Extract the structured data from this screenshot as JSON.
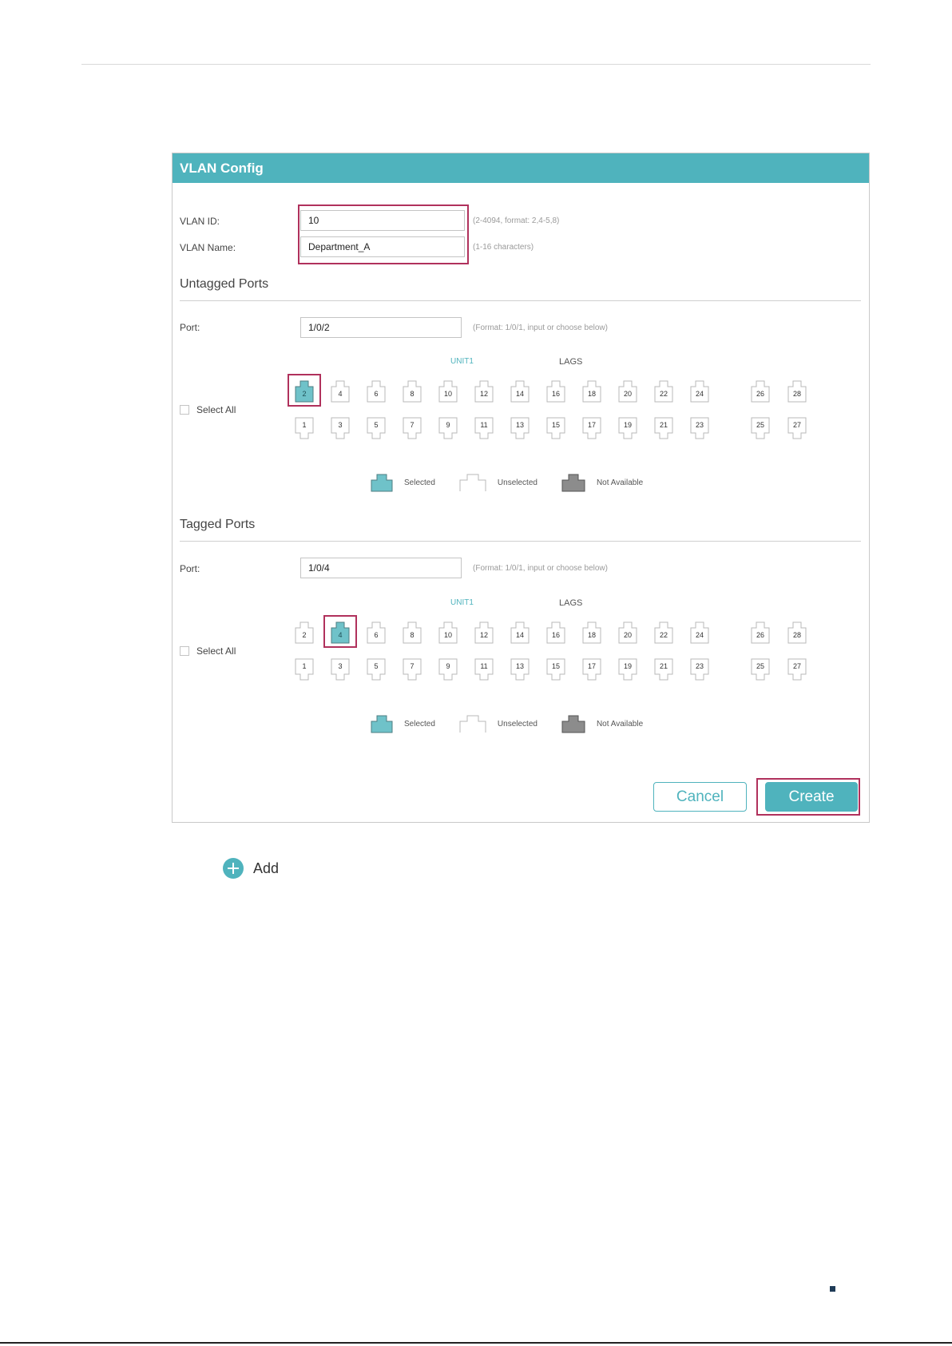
{
  "panel": {
    "title": "VLAN Config",
    "vlan_id": {
      "label": "VLAN ID:",
      "value": "10",
      "hint": "(2-4094, format: 2,4-5,8)"
    },
    "vlan_name": {
      "label": "VLAN Name:",
      "value": "Department_A",
      "hint": "(1-16 characters)"
    },
    "untagged": {
      "title": "Untagged Ports",
      "port_label": "Port:",
      "port_value": "1/0/2",
      "port_hint": "(Format: 1/0/1, input or choose below)",
      "unit_label": "UNIT1",
      "lags_label": "LAGS",
      "select_all": "Select All",
      "selected_port": "2"
    },
    "tagged": {
      "title": "Tagged Ports",
      "port_label": "Port:",
      "port_value": "1/0/4",
      "port_hint": "(Format: 1/0/1, input or choose below)",
      "unit_label": "UNIT1",
      "lags_label": "LAGS",
      "select_all": "Select All",
      "selected_port": "4"
    },
    "ports": {
      "top": [
        "2",
        "4",
        "6",
        "8",
        "10",
        "12",
        "14",
        "16",
        "18",
        "20",
        "22",
        "24",
        "26",
        "28"
      ],
      "bottom": [
        "1",
        "3",
        "5",
        "7",
        "9",
        "11",
        "13",
        "15",
        "17",
        "19",
        "21",
        "23",
        "25",
        "27"
      ]
    },
    "legend": {
      "selected": "Selected",
      "unselected": "Unselected",
      "not_available": "Not Available"
    },
    "buttons": {
      "cancel": "Cancel",
      "create": "Create"
    }
  },
  "add": {
    "label": "Add"
  },
  "colors": {
    "accent": "#4fb3bd",
    "highlight": "#b0315c",
    "unavailable": "#8c8c8c"
  }
}
